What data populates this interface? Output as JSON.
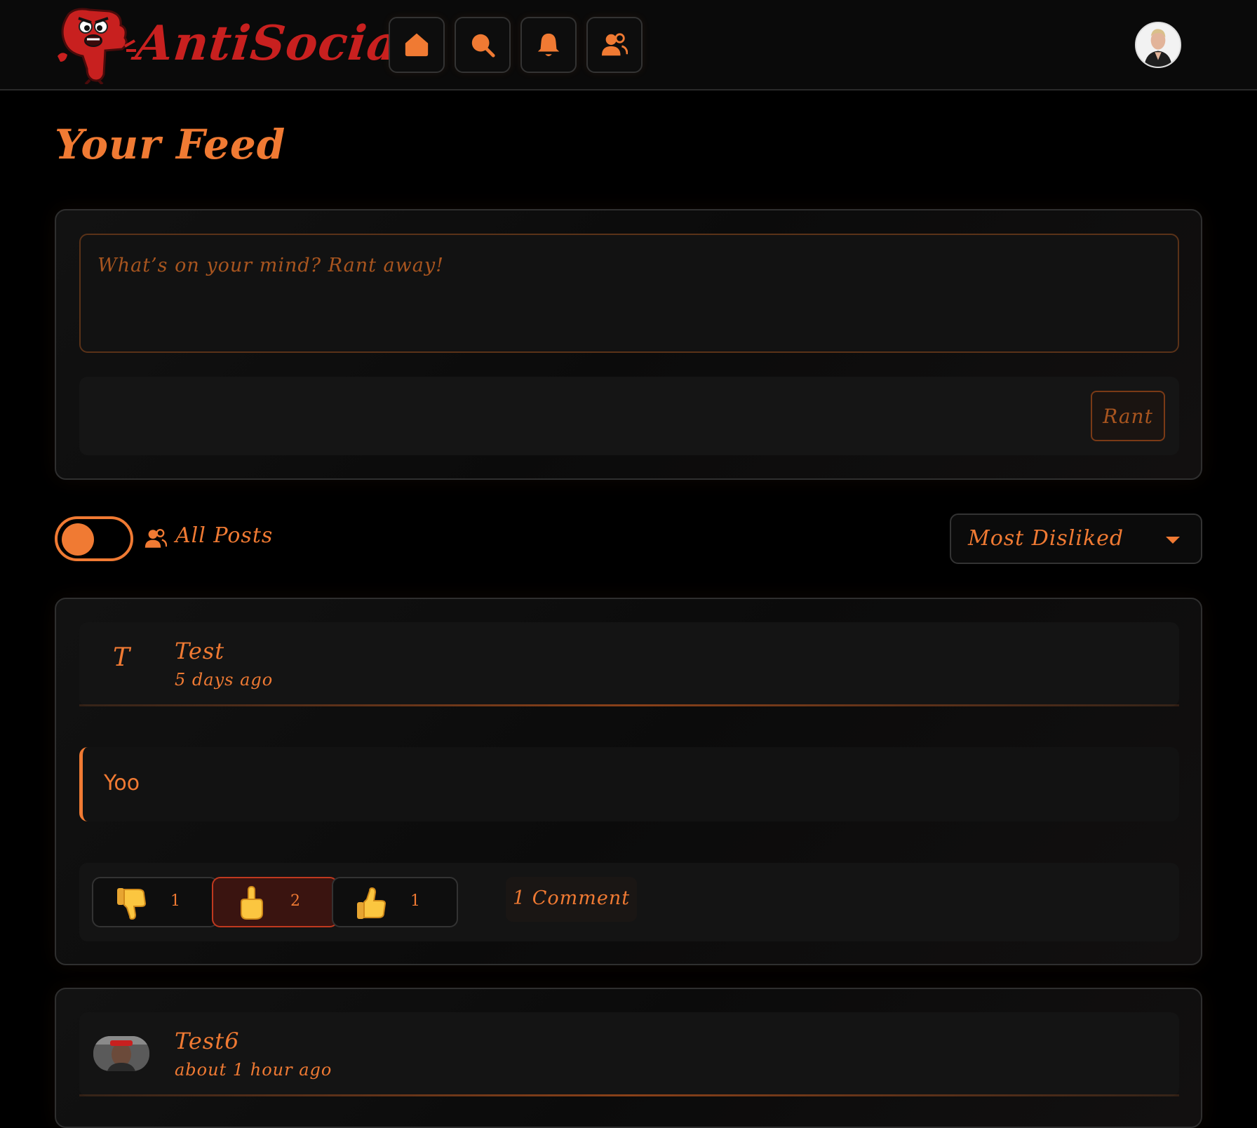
{
  "app": {
    "name": "AntiSocial",
    "accent": "#f07a33",
    "brand_red": "#c8201f"
  },
  "nav": {
    "buttons": [
      {
        "name": "home",
        "icon": "home-icon"
      },
      {
        "name": "search",
        "icon": "search-icon"
      },
      {
        "name": "notifications",
        "icon": "bell-icon"
      },
      {
        "name": "friends",
        "icon": "users-icon"
      }
    ]
  },
  "page": {
    "title": "Your Feed"
  },
  "composer": {
    "placeholder": "What’s on your mind? Rant away!",
    "value": "",
    "submit_label": "Rant"
  },
  "filter": {
    "toggle_on": true,
    "label": "All Posts",
    "sort_selected": "Most Disliked"
  },
  "posts": [
    {
      "initial": "T",
      "author": "Test",
      "time": "5 days ago",
      "text": "Yoo",
      "reactions": [
        {
          "icon": "thumbs-down-icon",
          "count": "1",
          "active": false
        },
        {
          "icon": "middle-finger-icon",
          "count": "2",
          "active": true
        },
        {
          "icon": "thumbs-up-icon",
          "count": "1",
          "active": false
        }
      ],
      "comments_label": "1 Comment"
    },
    {
      "initial": "",
      "author": "Test6",
      "time": "about 1 hour ago"
    }
  ]
}
